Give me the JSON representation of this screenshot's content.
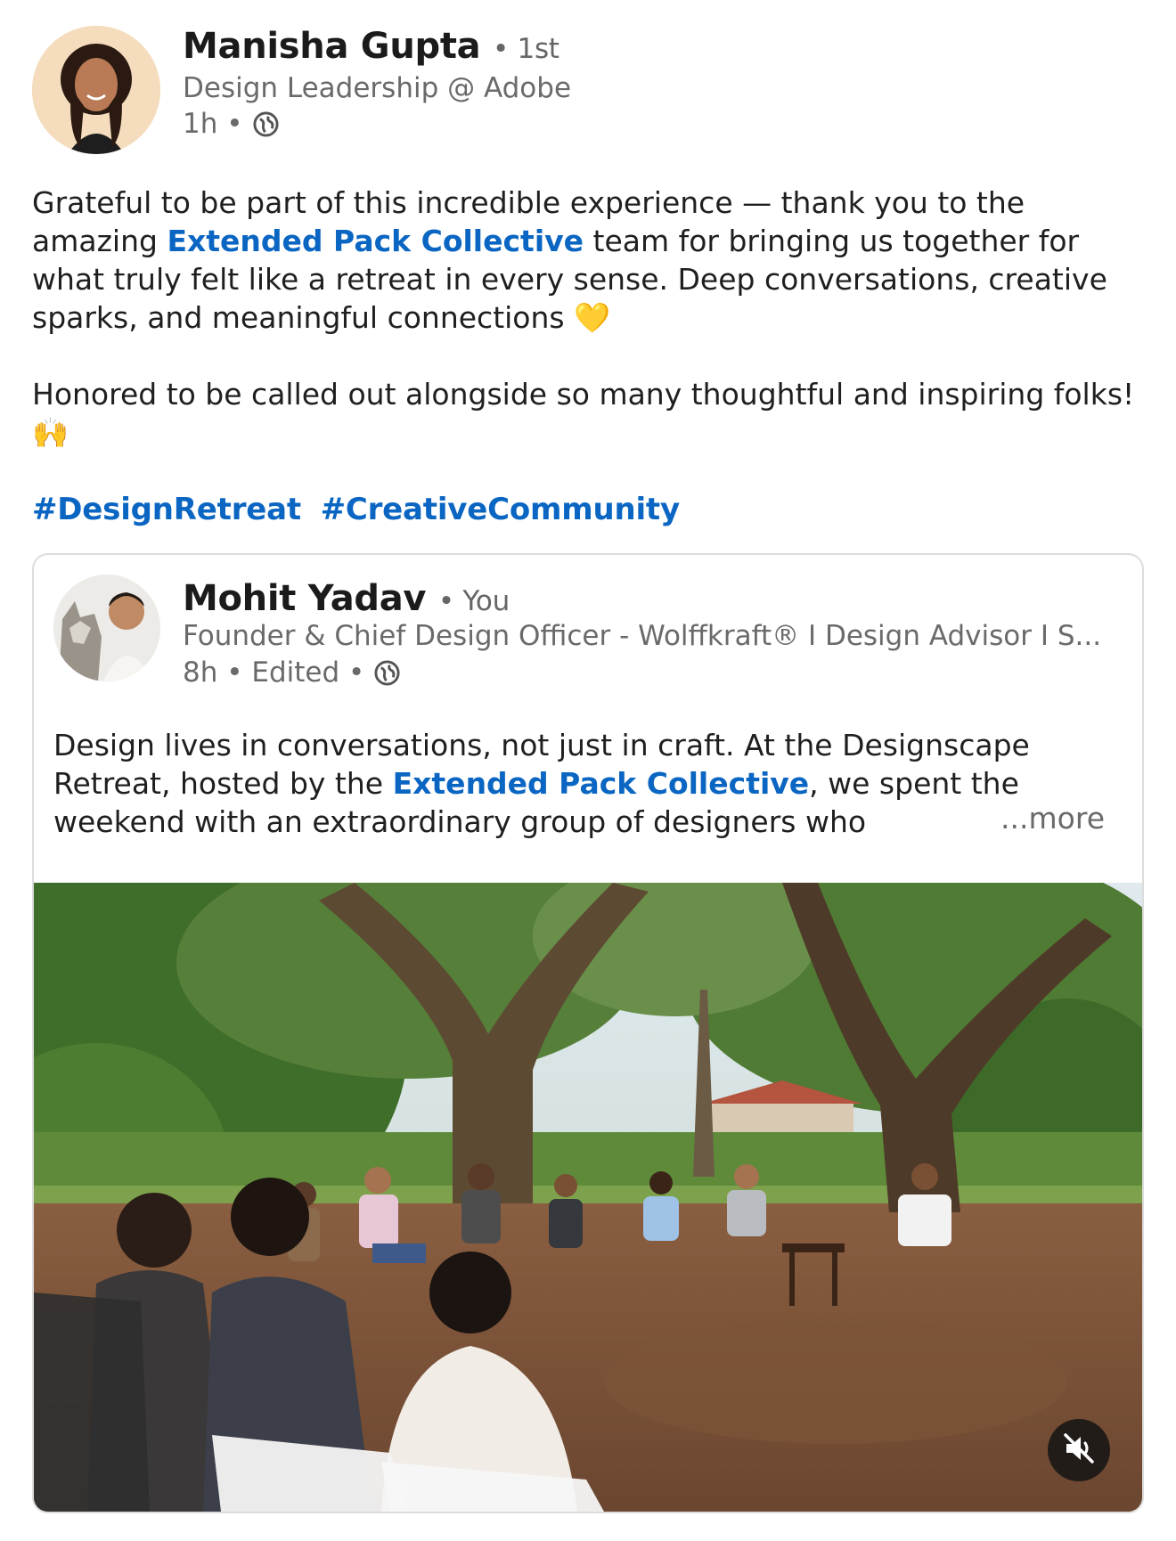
{
  "post": {
    "author": {
      "name": "Manisha Gupta",
      "degree": "• 1st",
      "headline": "Design Leadership @ Adobe",
      "time": "1h •"
    },
    "body": {
      "p1_a": "Grateful to be part of this incredible experience — thank you to the amazing ",
      "p1_link": "Extended Pack Collective",
      "p1_b": " team for bringing us together for what truly felt like a retreat in every sense. Deep conversations, creative sparks, and meaningful connections 💛",
      "p2": "Honored to be called out alongside so many thoughtful and inspiring folks! 🙌"
    },
    "hashtags": [
      "#DesignRetreat",
      "#CreativeCommunity"
    ]
  },
  "shared_post": {
    "author": {
      "name": "Mohit Yadav",
      "relation": "• You",
      "headline": "Founder & Chief Design Officer - Wolffkraft® I Design Advisor I S...",
      "time": "8h • Edited •"
    },
    "body": {
      "text_a": "Design lives in conversations, not just in craft. At the Designscape Retreat, hosted by the ",
      "link": "Extended Pack Collective",
      "text_b": ", we spent the weekend with an extraordinary group of designers who"
    },
    "more_label": "...more",
    "video": {
      "muted": true
    }
  },
  "colors": {
    "link": "#0a66c2",
    "text": "#1f1f1f",
    "secondary_text": "#6a6a6a",
    "card_border": "#dcdcdc"
  },
  "icons": [
    "globe-icon",
    "mute-icon"
  ]
}
